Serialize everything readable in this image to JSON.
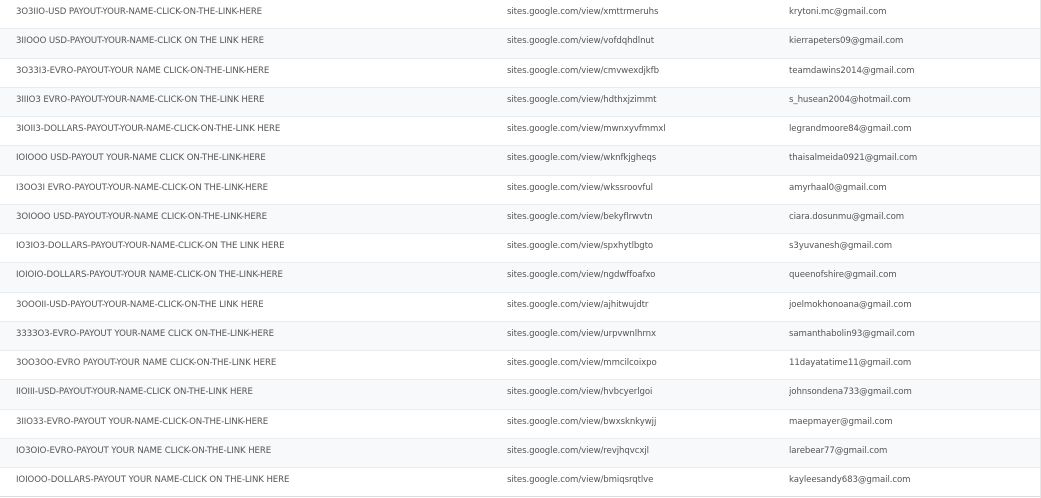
{
  "rows": [
    {
      "title": "3O3IIO-USD PAYOUT-YOUR-NAME-CLICK-ON-THE-LINK-HERE",
      "url": "sites.google.com/view/xmttrmeruhs",
      "email": "krytoni.mc@gmail.com"
    },
    {
      "title": "3IIOOO USD-PAYOUT-YOUR-NAME-CLICK ON THE LINK HERE",
      "url": "sites.google.com/view/vofdqhdlnut",
      "email": "kierrapeters09@gmail.com"
    },
    {
      "title": "3O33I3-EVRO-PAYOUT-YOUR NAME CLICK-ON-THE-LINK-HERE",
      "url": "sites.google.com/view/cmvwexdjkfb",
      "email": "teamdawins2014@gmail.com"
    },
    {
      "title": "3IIIO3 EVRO-PAYOUT-YOUR-NAME-CLICK-ON THE-LINK HERE",
      "url": "sites.google.com/view/hdthxjzimmt",
      "email": "s_husean2004@hotmail.com"
    },
    {
      "title": "3IOII3-DOLLARS-PAYOUT-YOUR-NAME-CLICK-ON-THE-LINK HERE",
      "url": "sites.google.com/view/mwnxyvfmmxl",
      "email": "legrandmoore84@gmail.com"
    },
    {
      "title": "IOIOOO USD-PAYOUT YOUR-NAME CLICK ON-THE-LINK-HERE",
      "url": "sites.google.com/view/wknfkjgheqs",
      "email": "thaisalmeida0921@gmail.com"
    },
    {
      "title": "I3OO3I EVRO-PAYOUT-YOUR-NAME-CLICK-ON THE-LINK-HERE",
      "url": "sites.google.com/view/wkssroovful",
      "email": "amyrhaal0@gmail.com"
    },
    {
      "title": "3OIOOO USD-PAYOUT-YOUR-NAME CLICK-ON-THE-LINK-HERE",
      "url": "sites.google.com/view/bekyflrwvtn",
      "email": "ciara.dosunmu@gmail.com"
    },
    {
      "title": "IO3IO3-DOLLARS-PAYOUT-YOUR-NAME-CLICK-ON THE LINK HERE",
      "url": "sites.google.com/view/spxhytlbgto",
      "email": "s3yuvanesh@gmail.com"
    },
    {
      "title": "IOIOIO-DOLLARS-PAYOUT-YOUR NAME-CLICK-ON THE-LINK-HERE",
      "url": "sites.google.com/view/ngdwffoafxo",
      "email": "queenofshire@gmail.com"
    },
    {
      "title": "3OOOII-USD-PAYOUT-YOUR-NAME-CLICK-ON-THE LINK HERE",
      "url": "sites.google.com/view/ajhitwujdtr",
      "email": "joelmokhonoana@gmail.com"
    },
    {
      "title": "333ЗО3-EVRO-PAYOUT YOUR-NAME CLICK ON-THE-LINK-HERE",
      "url": "sites.google.com/view/urpvwnlhrnx",
      "email": "samanthabolin93@gmail.com"
    },
    {
      "title": "3OO3OO-EVRO PAYOUT-YOUR NAME CLICK-ON-THE-LINK HERE",
      "url": "sites.google.com/view/mmcilcoixpo",
      "email": "11dayatatime11@gmail.com"
    },
    {
      "title": "IIOIII-USD-PAYOUT-YOUR-NAME-CLICK ON-THE-LINK HERE",
      "url": "sites.google.com/view/hvbcyerlgoi",
      "email": "johnsondena733@gmail.com"
    },
    {
      "title": "3IIO33-EVRO-PAYOUT YOUR-NAME-CLICK-ON-THE-LINK-HERE",
      "url": "sites.google.com/view/bwxsknkywjj",
      "email": "maepmayer@gmail.com"
    },
    {
      "title": "IO3OIO-EVRO-PAYOUT YOUR NAME CLICK-ON-THE-LINK HERE",
      "url": "sites.google.com/view/revjhqvcxjl",
      "email": "larebear77@gmail.com"
    },
    {
      "title": "IOIOOO-DOLLARS-PAYOUT YOUR NAME-CLICK ON THE-LINK HERE",
      "url": "sites.google.com/view/bmiqsrqtlve",
      "email": "kayleesandy683@gmail.com"
    }
  ]
}
